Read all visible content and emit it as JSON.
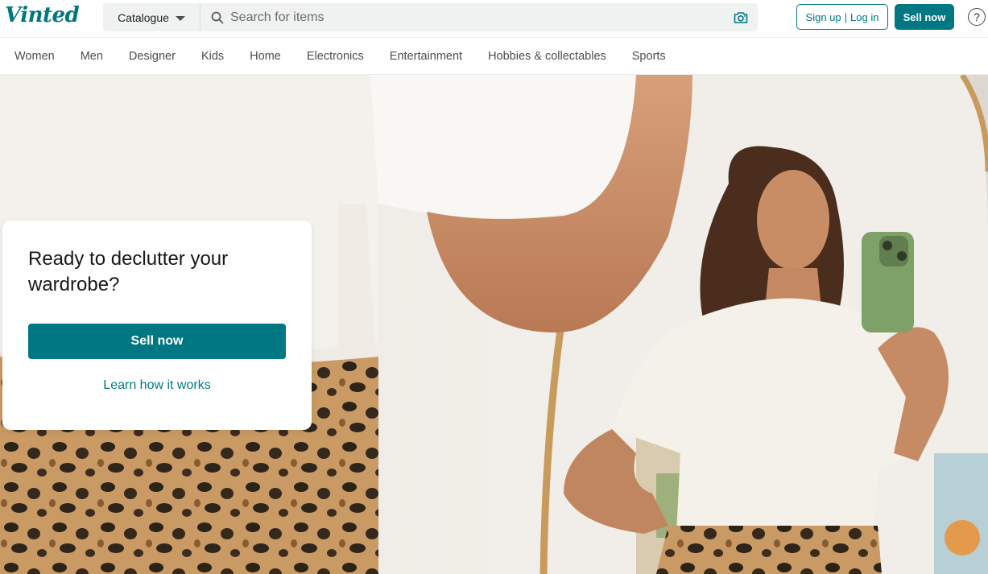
{
  "brand": {
    "logo_text": "Vinted",
    "accent": "#007782"
  },
  "header": {
    "catalogue_label": "Catalogue",
    "search_placeholder": "Search for items",
    "signup_label": "Sign up",
    "separator": "|",
    "login_label": "Log in",
    "sell_label": "Sell now",
    "help_symbol": "?"
  },
  "icons": {
    "search": "search-icon",
    "camera": "camera-icon",
    "dropdown": "chevron-down-icon",
    "help": "question-circle-icon"
  },
  "categories": [
    "Women",
    "Men",
    "Designer",
    "Kids",
    "Home",
    "Electronics",
    "Entertainment",
    "Hobbies & collectables",
    "Sports"
  ],
  "hero": {
    "title": "Ready to declutter your wardrobe?",
    "sell_button": "Sell now",
    "learn_link": "Learn how it works"
  }
}
